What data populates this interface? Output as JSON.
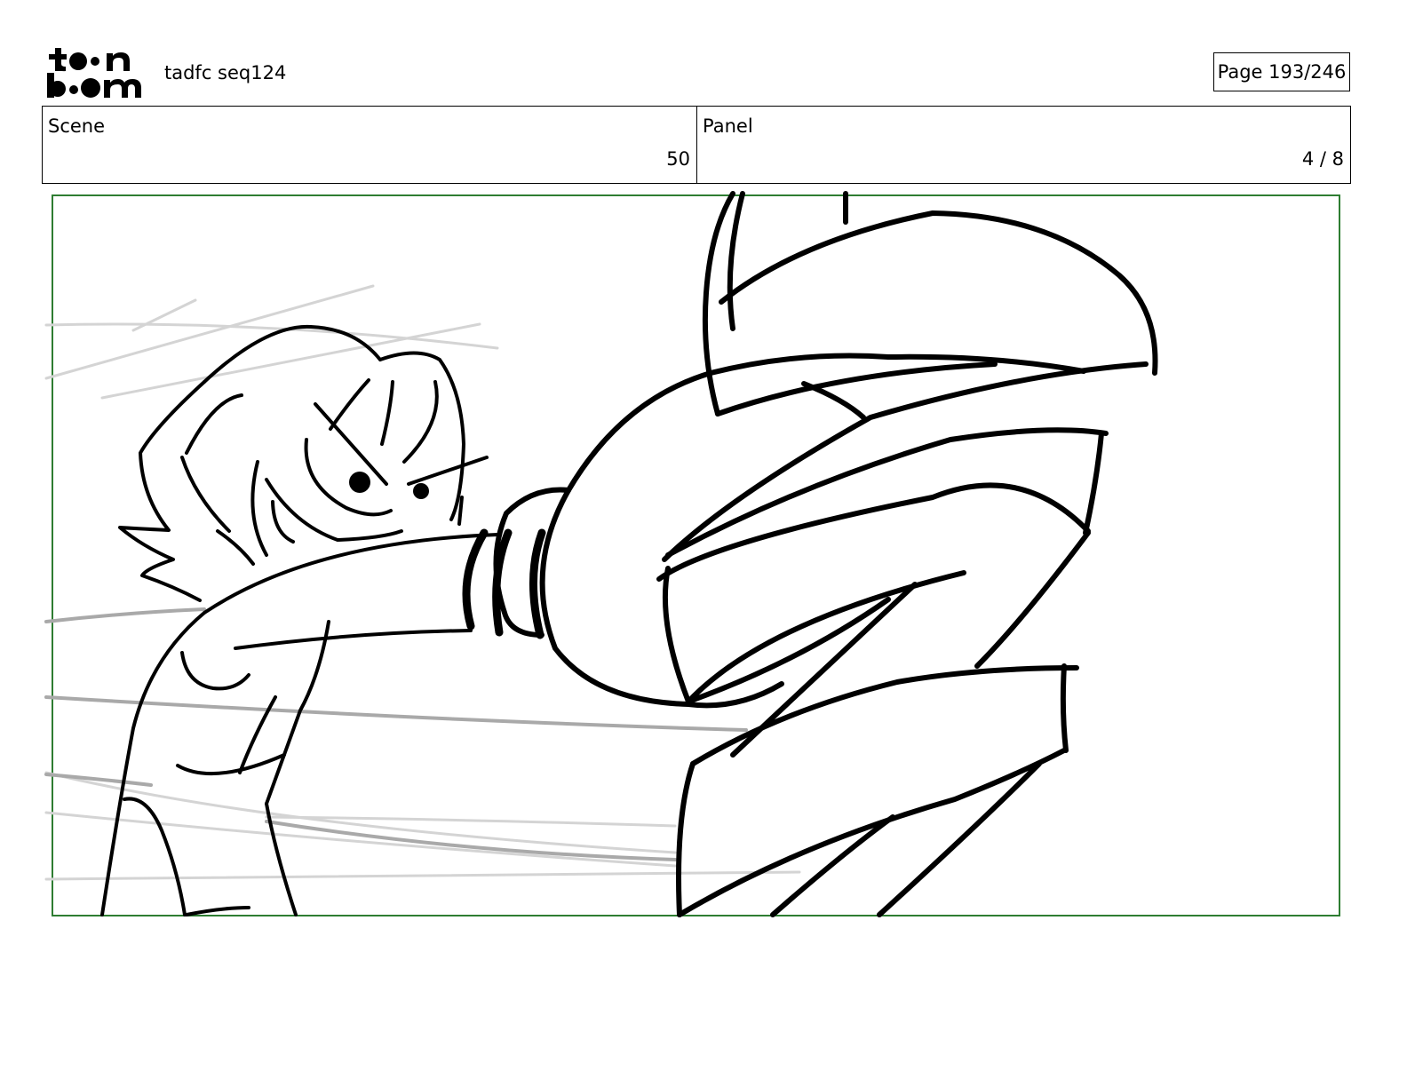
{
  "header": {
    "logo_text": "toon boom",
    "document_title": "tadfc seq124",
    "page_label": "Page 193/246"
  },
  "info": {
    "scene_label": "Scene",
    "scene_value": "50",
    "panel_label": "Panel",
    "panel_value": "4 / 8"
  },
  "colors": {
    "frame_border": "#2e7d32",
    "ink": "#000000",
    "background_lines": "#cccccc"
  }
}
